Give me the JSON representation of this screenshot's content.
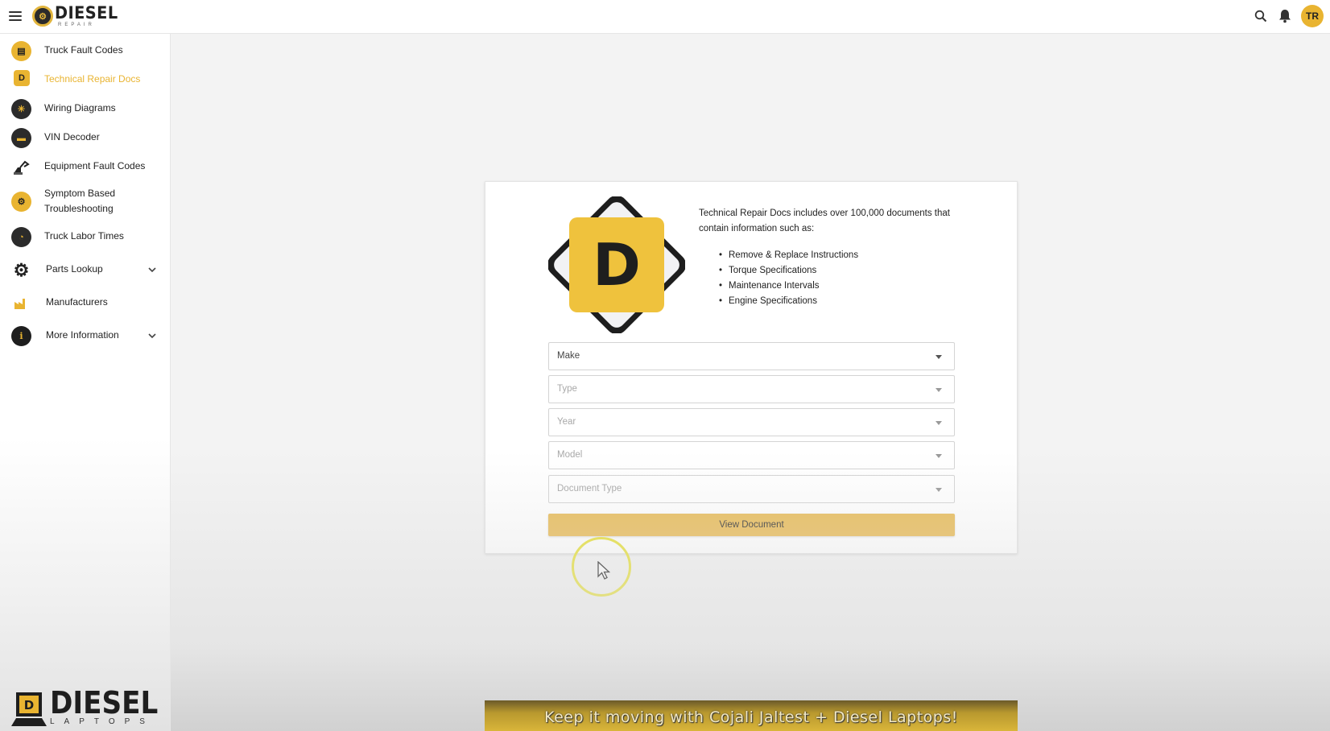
{
  "header": {
    "brand_name": "DIESEL",
    "brand_sub": "REPAIR",
    "avatar_initials": "TR"
  },
  "sidebar": {
    "items": [
      {
        "label": "Truck Fault Codes"
      },
      {
        "label": "Technical Repair Docs"
      },
      {
        "label": "Wiring Diagrams"
      },
      {
        "label": "VIN Decoder"
      },
      {
        "label": "Equipment Fault Codes"
      },
      {
        "label": "Symptom Based Troubleshooting"
      },
      {
        "label": "Truck Labor Times"
      },
      {
        "label": "Parts Lookup"
      },
      {
        "label": "Manufacturers"
      },
      {
        "label": "More Information"
      }
    ],
    "active_item": "Technical Repair Docs",
    "logo_main": "DIESEL",
    "logo_sub": "LAPTOPS"
  },
  "card": {
    "logo_letter": "D",
    "intro": "Technical Repair Docs includes over 100,000 documents that contain information such as:",
    "bullets": [
      "Remove & Replace Instructions",
      "Torque Specifications",
      "Maintenance Intervals",
      "Engine Specifications"
    ],
    "selects": {
      "make": "Make",
      "type": "Type",
      "year": "Year",
      "model": "Model",
      "document_type": "Document Type"
    },
    "view_button": "View Document"
  },
  "banner": {
    "text": "Keep it moving with Cojali Jaltest + Diesel Laptops!"
  },
  "colors": {
    "accent": "#e9b431",
    "button": "#e9bd5a",
    "cursor_ring": "#e8e23a"
  },
  "icons": {
    "menu": "hamburger-icon",
    "search": "search-icon",
    "notifications": "bell-icon"
  }
}
